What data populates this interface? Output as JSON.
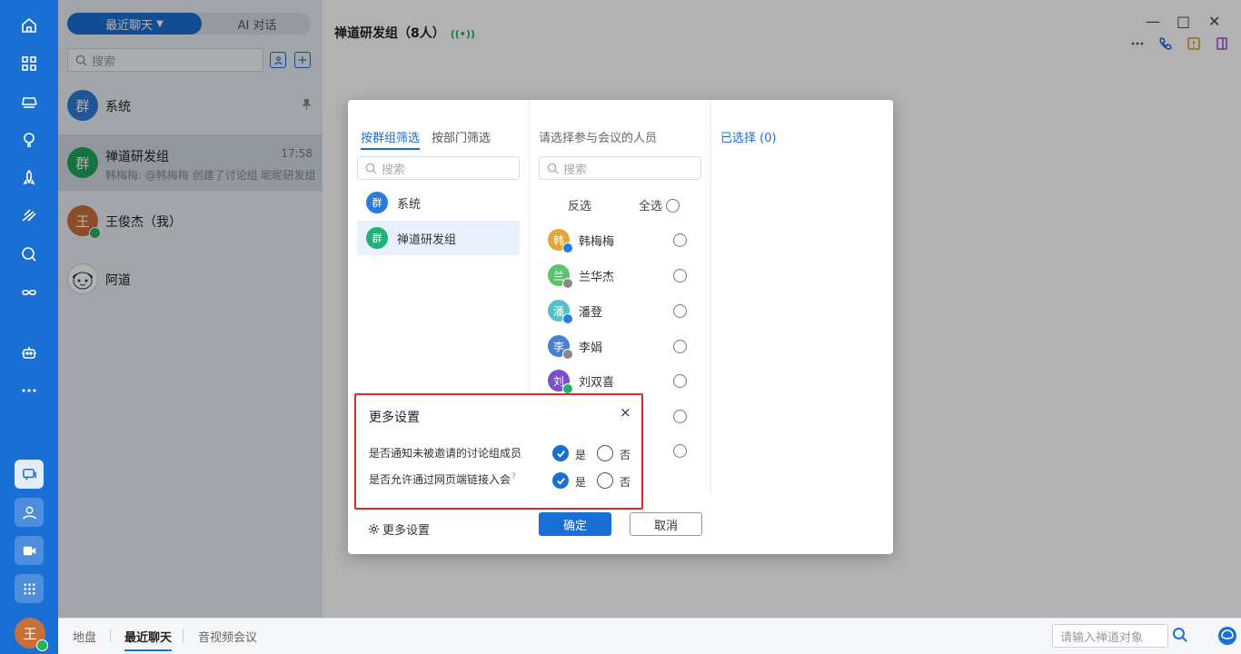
{
  "sidebar": {
    "avatar_initial": "王"
  },
  "list": {
    "tabs": {
      "recent": "最近聊天",
      "ai": "AI 对话"
    },
    "search_placeholder": "搜索",
    "conversations": [
      {
        "avatar": "群",
        "name": "系统",
        "sub": "",
        "time": "",
        "color": "#2b7bd8",
        "pinned": true
      },
      {
        "avatar": "群",
        "name": "禅道研发组",
        "sub": "韩梅梅: @韩梅梅 创建了讨论组 昵昵研发组",
        "time": "17:58",
        "color": "#22a45d"
      },
      {
        "avatar": "王",
        "name": "王俊杰（我）",
        "sub": "",
        "time": "",
        "color": "#c7703a"
      },
      {
        "avatar": "",
        "name": "阿道",
        "sub": "",
        "time": "",
        "color": "#ffffff"
      }
    ]
  },
  "chat": {
    "title": "禅道研发组（8人）"
  },
  "bottom": {
    "tabs": [
      "地盘",
      "最近聊天",
      "音视频会议"
    ],
    "search_placeholder": "请输入禅道对象"
  },
  "dialog": {
    "tab_group": "按群组筛选",
    "tab_dept": "按部门筛选",
    "search_placeholder": "搜索",
    "groups": [
      {
        "avatar": "群",
        "name": "系统",
        "color": "#2b7bd8"
      },
      {
        "avatar": "群",
        "name": "禅道研发组",
        "color": "#22b07a"
      }
    ],
    "people_header": "请选择参与会议的人员",
    "invert": "反选",
    "select_all": "全选",
    "people": [
      {
        "initial": "韩",
        "name": "韩梅梅",
        "color": "#e0a63a",
        "badge": "#2b7bd8"
      },
      {
        "initial": "兰",
        "name": "兰华杰",
        "color": "#5bc46a",
        "badge": "#888888"
      },
      {
        "initial": "潘",
        "name": "潘登",
        "color": "#56c2c6",
        "badge": "#2b7bd8"
      },
      {
        "initial": "李",
        "name": "李娟",
        "color": "#4a7fd0",
        "badge": "#888888"
      },
      {
        "initial": "刘",
        "name": "刘双喜",
        "color": "#7b4fc6",
        "badge": "#22b35e"
      }
    ],
    "selected_label": "已选择 (0)",
    "ok": "确定",
    "cancel": "取消",
    "more_settings": "更多设置"
  },
  "popup": {
    "title": "更多设置",
    "close": "×",
    "q1": "是否通知未被邀请的讨论组成员",
    "q2": "是否允许通过网页端链接入会",
    "yes": "是",
    "no": "否"
  }
}
